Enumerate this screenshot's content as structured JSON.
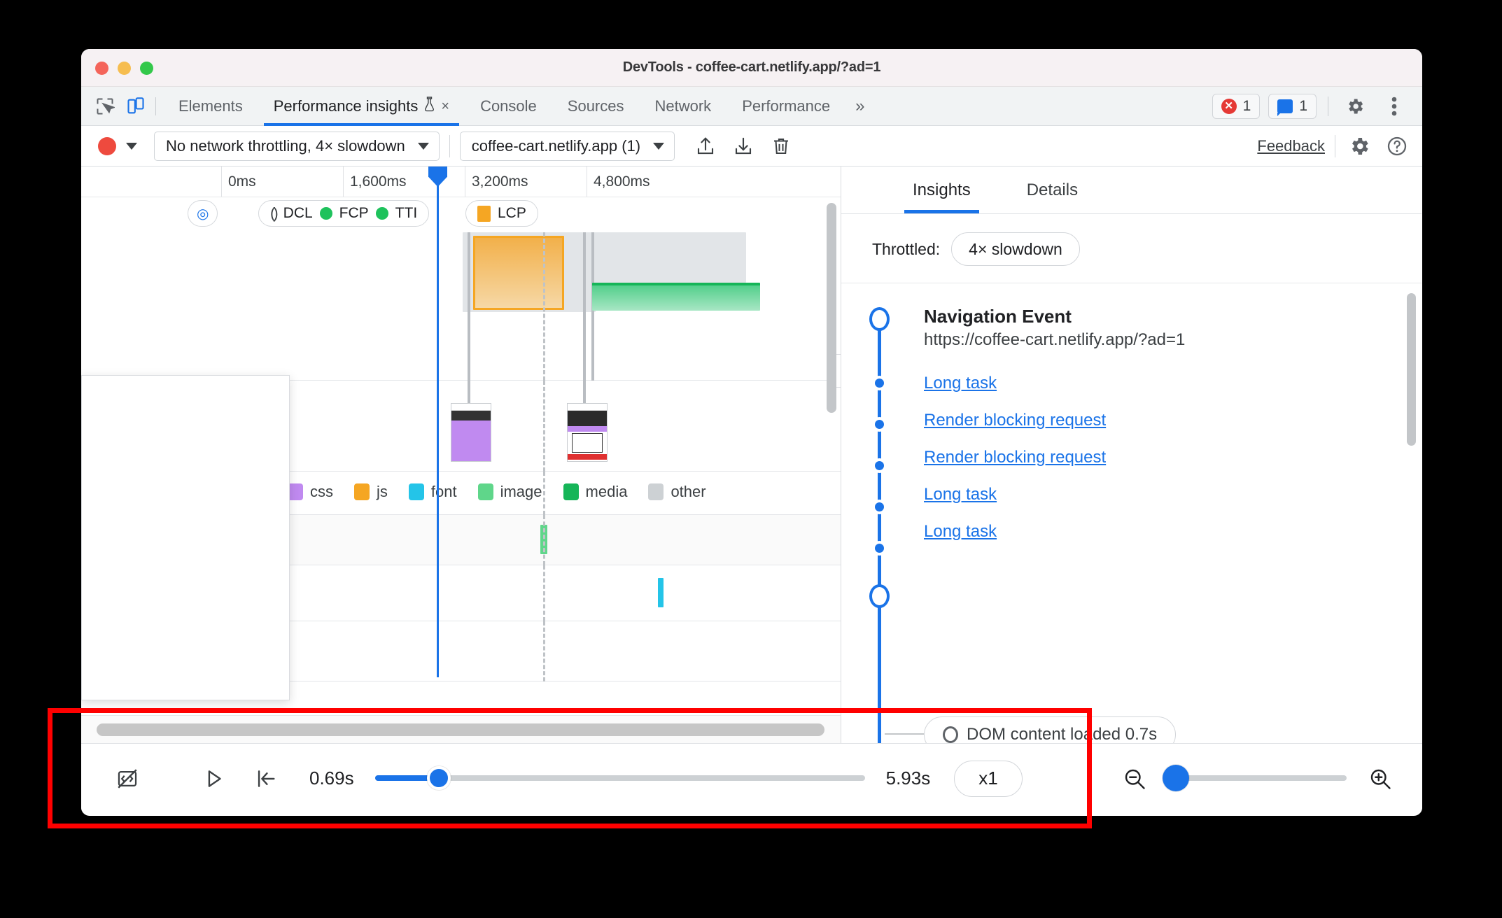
{
  "window": {
    "title": "DevTools - coffee-cart.netlify.app/?ad=1",
    "traffic_lights": [
      "close",
      "minimize",
      "maximize"
    ]
  },
  "tabbar": {
    "inspect_icon": "inspect-element-icon",
    "device_icon": "device-toolbar-icon",
    "tabs": [
      {
        "label": "Elements",
        "active": false
      },
      {
        "label": "Performance insights",
        "active": true,
        "experimental": true,
        "closable": true
      },
      {
        "label": "Console",
        "active": false
      },
      {
        "label": "Sources",
        "active": false
      },
      {
        "label": "Network",
        "active": false
      },
      {
        "label": "Performance",
        "active": false
      }
    ],
    "overflow_label": "»",
    "error_count": "1",
    "message_count": "1",
    "settings_icon": "gear-icon",
    "more_icon": "three-dot-menu-icon",
    "close_glyph": "×",
    "flask_glyph": "⚗"
  },
  "toolbar": {
    "record_label": "record-button",
    "throttling_select": "No network throttling, 4× slowdown",
    "page_select": "coffee-cart.netlify.app (1)",
    "upload_icon": "upload-icon",
    "download_icon": "download-icon",
    "trash_icon": "trash-icon",
    "feedback_label": "Feedback",
    "settings_icon": "settings-gear-icon",
    "help_icon": "help-icon"
  },
  "timeline": {
    "ruler_ticks": [
      "0ms",
      "1,600ms",
      "3,200ms",
      "4,800ms"
    ],
    "markers": [
      {
        "label": "DCL",
        "type": "glyph"
      },
      {
        "label": "FCP",
        "type": "dot-green"
      },
      {
        "label": "TTI",
        "type": "dot-green"
      },
      {
        "label": "LCP",
        "type": "square-orange"
      }
    ],
    "legend": [
      {
        "label": "css",
        "color": "#c08af0"
      },
      {
        "label": "js",
        "color": "#f5a623"
      },
      {
        "label": "font",
        "color": "#24c4e8"
      },
      {
        "label": "image",
        "color": "#5fd68a"
      },
      {
        "label": "media",
        "color": "#16b558"
      },
      {
        "label": "other",
        "color": "#cdd1d4"
      }
    ],
    "expand_handle": "›"
  },
  "sidebar": {
    "tabs": [
      {
        "label": "Insights",
        "active": true
      },
      {
        "label": "Details",
        "active": false
      }
    ],
    "throttled_label": "Throttled:",
    "throttled_value": "4× slowdown",
    "navigation_title": "Navigation Event",
    "navigation_url": "https://coffee-cart.netlify.app/?ad=1",
    "items": [
      {
        "label": "Long task"
      },
      {
        "label": "Render blocking request"
      },
      {
        "label": "Render blocking request"
      },
      {
        "label": "Long task"
      },
      {
        "label": "Long task"
      }
    ],
    "dom_chip": "DOM content loaded 0.7s"
  },
  "controlbar": {
    "filmstrip_icon": "filmstrip-toggle-icon",
    "play_icon": "play-icon",
    "jump_start_icon": "jump-to-start-icon",
    "time_start": "0.69s",
    "time_end": "5.93s",
    "speed_label": "x1",
    "zoom_out_icon": "zoom-out-icon",
    "zoom_in_icon": "zoom-in-icon",
    "scrub_percent": 13,
    "zoom_percent": 0
  },
  "annotation": {
    "highlight_color": "#ff0000"
  }
}
